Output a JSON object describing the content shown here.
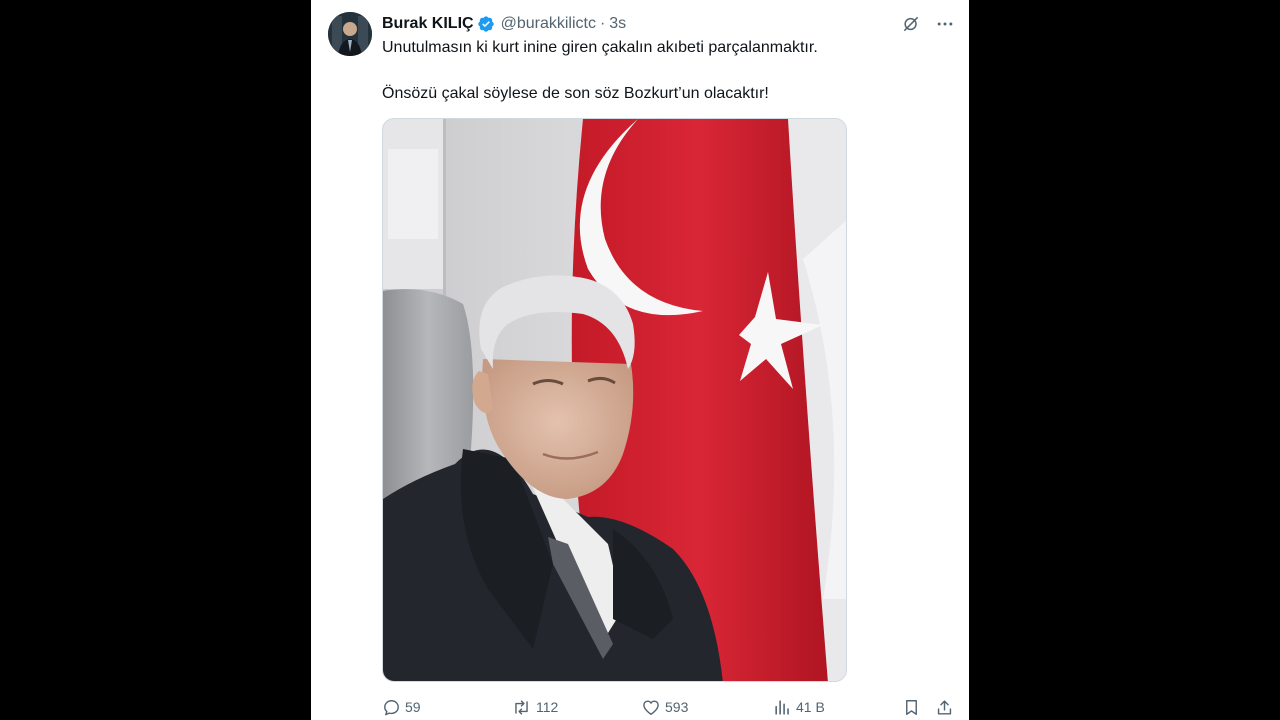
{
  "tweet": {
    "author": {
      "display_name": "Burak KILIÇ",
      "handle": "@burakkilictc",
      "verified": true,
      "avatar_icon": "avatar-photo"
    },
    "separator": "·",
    "time": "3s",
    "text_lines": [
      "Unutulmasın ki kurt inine giren çakalın akıbeti parçalanmaktır.",
      "Önsözü çakal söylese de son söz Bozkurt’un olacaktır!"
    ],
    "media": {
      "kind": "photo",
      "subject": "elderly man in dark suit seated before Turkish flag"
    },
    "stats": {
      "replies": "59",
      "reposts": "112",
      "likes": "593",
      "views": "41 B"
    },
    "icons": {
      "grok": "grok-icon",
      "more": "more-icon",
      "reply": "reply-icon",
      "repost": "repost-icon",
      "like": "like-icon",
      "views": "views-icon",
      "bookmark": "bookmark-icon",
      "share": "share-icon"
    }
  },
  "colors": {
    "verified_blue": "#1d9bf0",
    "text_primary": "#0f1419",
    "text_secondary": "#536471",
    "flag_red": "#d4212e",
    "background": "#000000"
  }
}
